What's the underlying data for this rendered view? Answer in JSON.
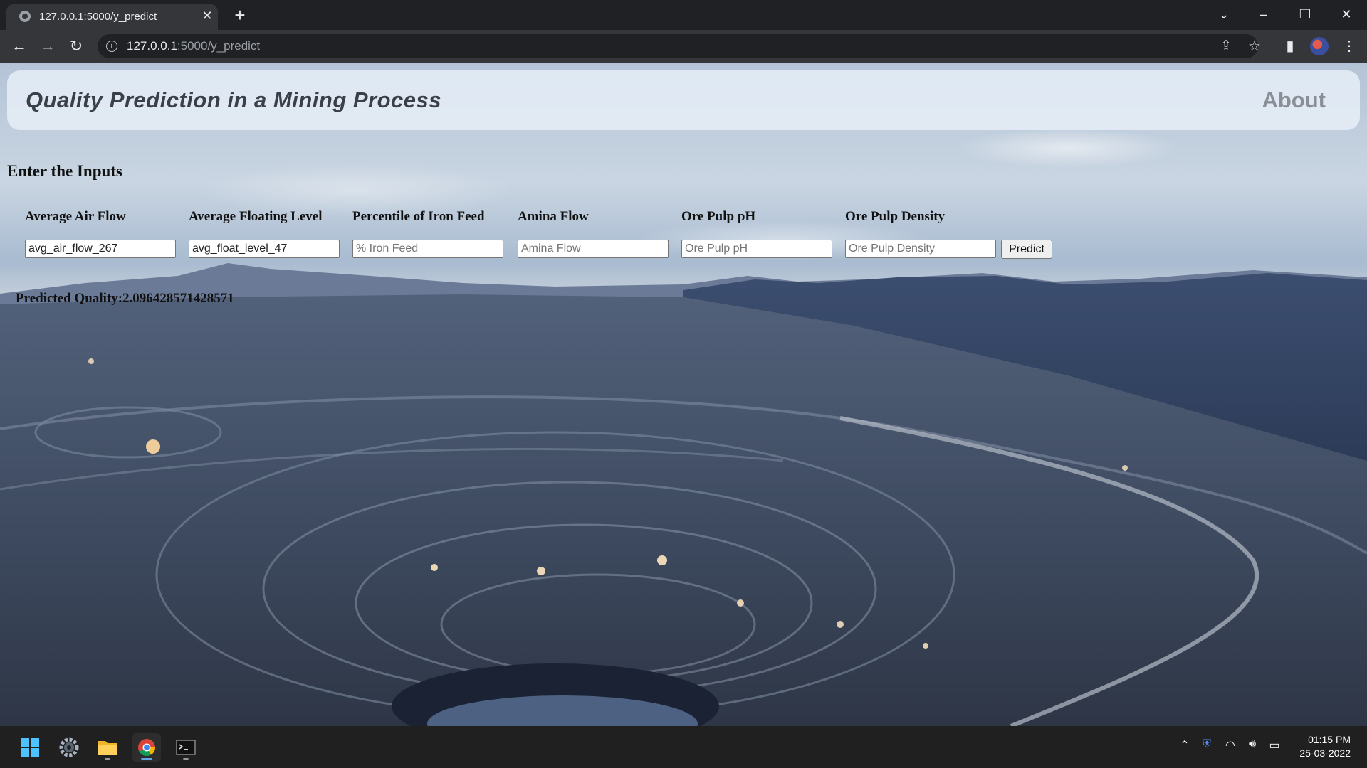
{
  "browser": {
    "tab_title": "127.0.0.1:5000/y_predict",
    "url_host": "127.0.0.1",
    "url_path": ":5000/y_predict"
  },
  "page": {
    "site_title": "Quality Prediction in a Mining Process",
    "about_link": "About",
    "section_heading": "Enter the Inputs",
    "fields": [
      {
        "label": "Average Air Flow",
        "value": "avg_air_flow_267",
        "placeholder": ""
      },
      {
        "label": "Average Floating Level",
        "value": "avg_float_level_47",
        "placeholder": ""
      },
      {
        "label": "Percentile of Iron Feed",
        "value": "",
        "placeholder": "% Iron Feed"
      },
      {
        "label": "Amina Flow",
        "value": "",
        "placeholder": "Amina Flow"
      },
      {
        "label": "Ore Pulp pH",
        "value": "",
        "placeholder": "Ore Pulp pH"
      },
      {
        "label": "Ore Pulp Density",
        "value": "",
        "placeholder": "Ore Pulp Density"
      }
    ],
    "predict_button": "Predict",
    "result": "Predicted Quality:2.096428571428571"
  },
  "taskbar": {
    "time": "01:15 PM",
    "date": "25-03-2022"
  }
}
